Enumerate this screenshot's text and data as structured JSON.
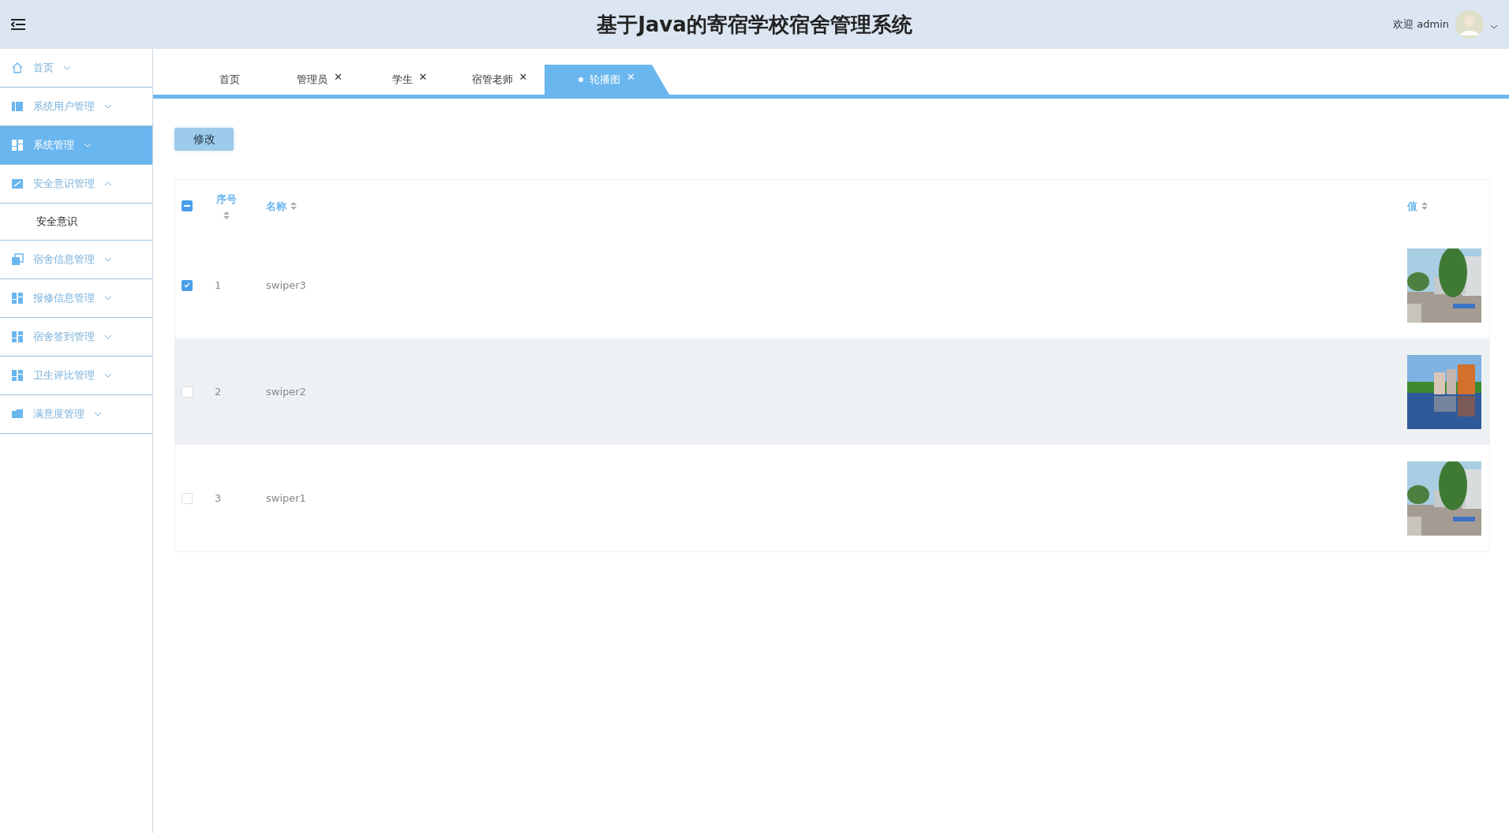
{
  "header": {
    "title": "基于Java的寄宿学校宿舍管理系统",
    "welcome": "欢迎 admin"
  },
  "sidebar": {
    "items": [
      {
        "label": "首页",
        "selected": false,
        "expanded": false
      },
      {
        "label": "系统用户管理",
        "selected": false,
        "expanded": false
      },
      {
        "label": "系统管理",
        "selected": true,
        "expanded": false
      },
      {
        "label": "安全意识管理",
        "selected": false,
        "expanded": true,
        "children": [
          {
            "label": "安全意识",
            "selected": false
          }
        ]
      },
      {
        "label": "宿舍信息管理",
        "selected": false,
        "expanded": false
      },
      {
        "label": "报修信息管理",
        "selected": false,
        "expanded": false
      },
      {
        "label": "宿舍签到管理",
        "selected": false,
        "expanded": false
      },
      {
        "label": "卫生评比管理",
        "selected": false,
        "expanded": false
      },
      {
        "label": "满意度管理",
        "selected": false,
        "expanded": false
      }
    ]
  },
  "tabs": [
    {
      "label": "首页",
      "selected": false
    },
    {
      "label": "管理员",
      "close": "✕",
      "selected": false
    },
    {
      "label": "学生",
      "close": "✕",
      "selected": false
    },
    {
      "label": "宿管老师",
      "close": "✕",
      "selected": false
    },
    {
      "label": "轮播图",
      "close": "✕",
      "selected": true
    }
  ],
  "toolbar": {
    "edit_button": "修改"
  },
  "table": {
    "select_all": {
      "indeterminate": true
    },
    "columns": [
      "序号",
      "名称",
      "值"
    ],
    "rows": [
      {
        "index": "1",
        "name": "swiper3",
        "checked": true,
        "highlighted": false
      },
      {
        "index": "2",
        "name": "swiper2",
        "checked": false,
        "highlighted": true
      },
      {
        "index": "3",
        "name": "swiper1",
        "checked": false,
        "highlighted": false
      }
    ]
  }
}
